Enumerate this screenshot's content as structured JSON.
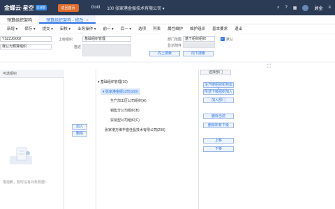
{
  "topbar": {
    "logo": "金蝶云·星空",
    "logo_badge": "企业版",
    "highlight_button": "返回首页",
    "edition": "Gold",
    "org": "100  张家港金振技术有限公司 ▾",
    "user": "顾金"
  },
  "tabs": [
    {
      "label": "预算组织架构"
    },
    {
      "label": "预算组织架构 - 修改"
    }
  ],
  "toolbar": {
    "items": [
      "新增 ▾",
      "保存 ▾",
      "提交 ▾",
      "审核 ▾",
      "业务操作 ▾",
      "前一 ▾",
      "后一 ▾",
      "选项",
      "列表",
      "属性维护",
      "维护组织",
      "基本要求",
      "退出"
    ]
  },
  "form": {
    "code_value": "YSZZJG002",
    "name_label": "名称",
    "name_value": "我认为预算组织",
    "parent_label": "上级组织",
    "parent_value": "基础组织管理",
    "desc_label": "描述",
    "dept_label": "部门范围",
    "dept_value": "基于组织组织",
    "default_label": "默认",
    "source_label": "显示附件",
    "up_button": "向上搜索",
    "down_button": "向下搜索"
  },
  "left_panel": {
    "title": "可选组织",
    "empty_text": "很抱歉，暂时没有对象数据~"
  },
  "middle_buttons": {
    "add": "加入",
    "delete": "删除"
  },
  "tree": {
    "root": "▾ 基础组织管理(10)",
    "selected": "▾ 张家港金振公司(100)",
    "children": [
      "生产加工区公司组织(A)",
      "销售分公司组织(B)",
      "贸易型公司组织(C)",
      "张家港万维丰盛佳昌技术有限公司(200)"
    ]
  },
  "right_panel": {
    "title": "选择部门",
    "buttons": [
      "没汽搜组织机构加入",
      "所选下级组织加入",
      "加入部门",
      "删除当前",
      "删除所有下级",
      "上移",
      "下移"
    ]
  }
}
